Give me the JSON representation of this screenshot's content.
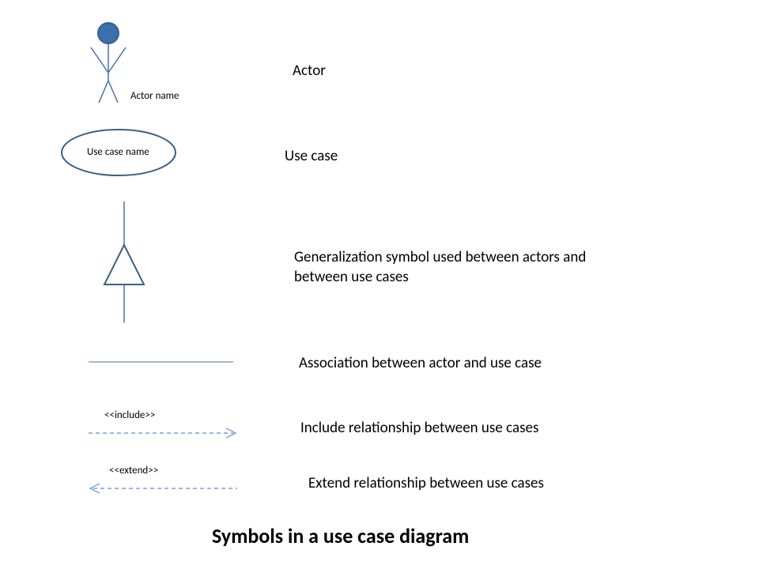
{
  "symbols": {
    "actor": {
      "caption": "Actor name",
      "description": "Actor"
    },
    "usecase": {
      "caption": "Use case name",
      "description": "Use case"
    },
    "generalization": {
      "description": "Generalization symbol used between actors and between use cases"
    },
    "association": {
      "description": "Association between actor and use case"
    },
    "include": {
      "caption": "<<include>>",
      "description": "Include relationship between use cases"
    },
    "extend": {
      "caption": "<<extend>>",
      "description": "Extend relationship between use cases"
    }
  },
  "title": "Symbols in a use case diagram",
  "colors": {
    "stroke": "#4473a8",
    "fill": "#3c6fb0",
    "dash": "#5b8fd0"
  }
}
